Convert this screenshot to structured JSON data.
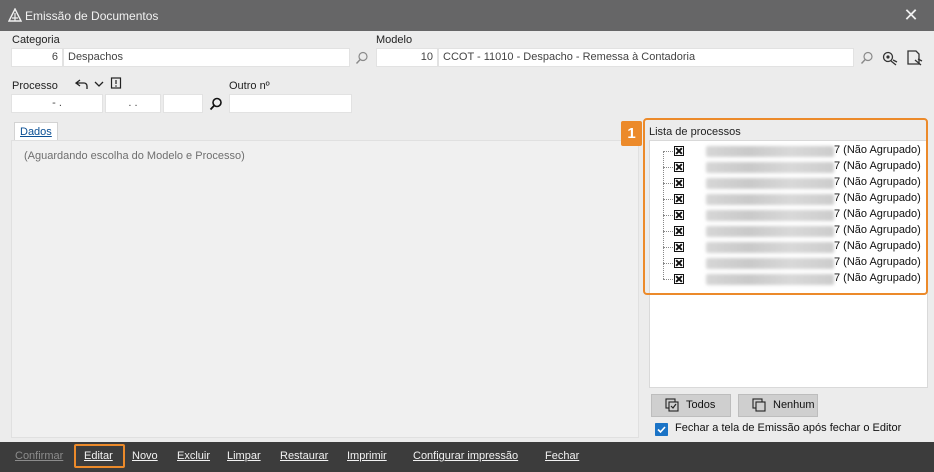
{
  "window": {
    "title": "Emissão de Documentos"
  },
  "categoria": {
    "label": "Categoria",
    "code": "6",
    "name": "Despachos"
  },
  "modelo": {
    "label": "Modelo",
    "code": "10",
    "name": "CCOT - 11010 - Despacho - Remessa à Contadoria"
  },
  "processo": {
    "label": "Processo",
    "field1": "- .",
    "field2": ". .",
    "field3": ""
  },
  "outro": {
    "label": "Outro nº",
    "value": ""
  },
  "tabs": {
    "dados": "Dados"
  },
  "main": {
    "waiting_text": "(Aguardando escolha do Modelo e Processo)"
  },
  "lista": {
    "label": "Lista de processos",
    "items": [
      "7 (Não Agrupado)",
      "7 (Não Agrupado)",
      "7 (Não Agrupado)",
      "7 (Não Agrupado)",
      "7 (Não Agrupado)",
      "7 (Não Agrupado)",
      "7 (Não Agrupado)",
      "7 (Não Agrupado)",
      "7 (Não Agrupado)"
    ]
  },
  "buttons": {
    "todos": "Todos",
    "nenhum": "Nenhum"
  },
  "option": {
    "fechar_label": "Fechar a tela de Emissão após fechar o Editor",
    "checked": true
  },
  "callout": {
    "number": "1"
  },
  "actions": {
    "confirmar": "Confirmar",
    "editar": "Editar",
    "novo": "Novo",
    "excluir": "Excluir",
    "limpar": "Limpar",
    "restaurar": "Restaurar",
    "imprimir": "Imprimir",
    "configurar": "Configurar impressão",
    "fechar": "Fechar"
  },
  "colors": {
    "titlebar": "#666667",
    "accent": "#ec8a2a",
    "link": "#0a4f94",
    "checkbox": "#1a73c6",
    "actionbar": "#3c3c3c"
  }
}
